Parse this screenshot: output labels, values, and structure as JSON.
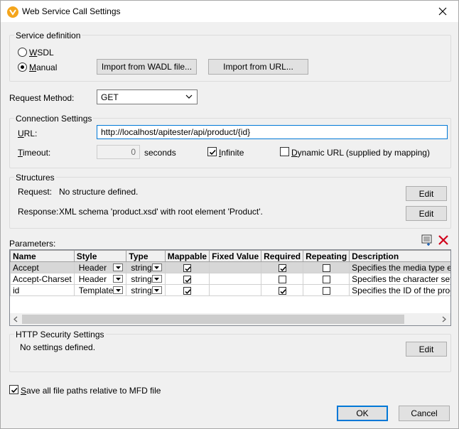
{
  "window": {
    "title": "Web Service Call Settings"
  },
  "service_definition": {
    "group_label": "Service definition",
    "wsdl_label": "WSDL",
    "wsdl_selected": false,
    "manual_label": "Manual",
    "manual_selected": true,
    "import_wadl_button": "Import from WADL file...",
    "import_url_button": "Import from URL..."
  },
  "request_method": {
    "label": "Request Method:",
    "value": "GET"
  },
  "connection": {
    "group_label": "Connection Settings",
    "url_label": "URL:",
    "url_value": "http://localhost/apitester/api/product/{id}",
    "timeout_label": "Timeout:",
    "timeout_value": "0",
    "seconds_label": "seconds",
    "infinite_label": "Infinite",
    "infinite_checked": true,
    "dynamic_url_label": "Dynamic URL (supplied by mapping)",
    "dynamic_url_checked": false
  },
  "structures": {
    "group_label": "Structures",
    "request_label": "Request:",
    "request_value": "No structure defined.",
    "request_edit": "Edit",
    "response_label": "Response:",
    "response_value": "XML schema 'product.xsd' with root element 'Product'.",
    "response_edit": "Edit"
  },
  "parameters": {
    "label": "Parameters:",
    "columns": [
      "Name",
      "Style",
      "Type",
      "Mappable",
      "Fixed Value",
      "Required",
      "Repeating",
      "Description"
    ],
    "rows": [
      {
        "name": "Accept",
        "style": "Header",
        "type": "string",
        "mappable": true,
        "fixed_value": "",
        "required": true,
        "repeating": false,
        "description": "Specifies the media type expected by"
      },
      {
        "name": "Accept-Charset",
        "style": "Header",
        "type": "string",
        "mappable": true,
        "fixed_value": "",
        "required": false,
        "repeating": false,
        "description": "Specifies the character set expected"
      },
      {
        "name": "id",
        "style": "Template",
        "type": "string",
        "mappable": true,
        "fixed_value": "",
        "required": true,
        "repeating": false,
        "description": "Specifies the ID of the product to ret"
      }
    ]
  },
  "http_security": {
    "group_label": "HTTP Security Settings",
    "value": "No settings defined.",
    "edit": "Edit"
  },
  "footer": {
    "save_relative_label": "Save all file paths relative to MFD file",
    "save_relative_checked": true,
    "ok": "OK",
    "cancel": "Cancel"
  }
}
